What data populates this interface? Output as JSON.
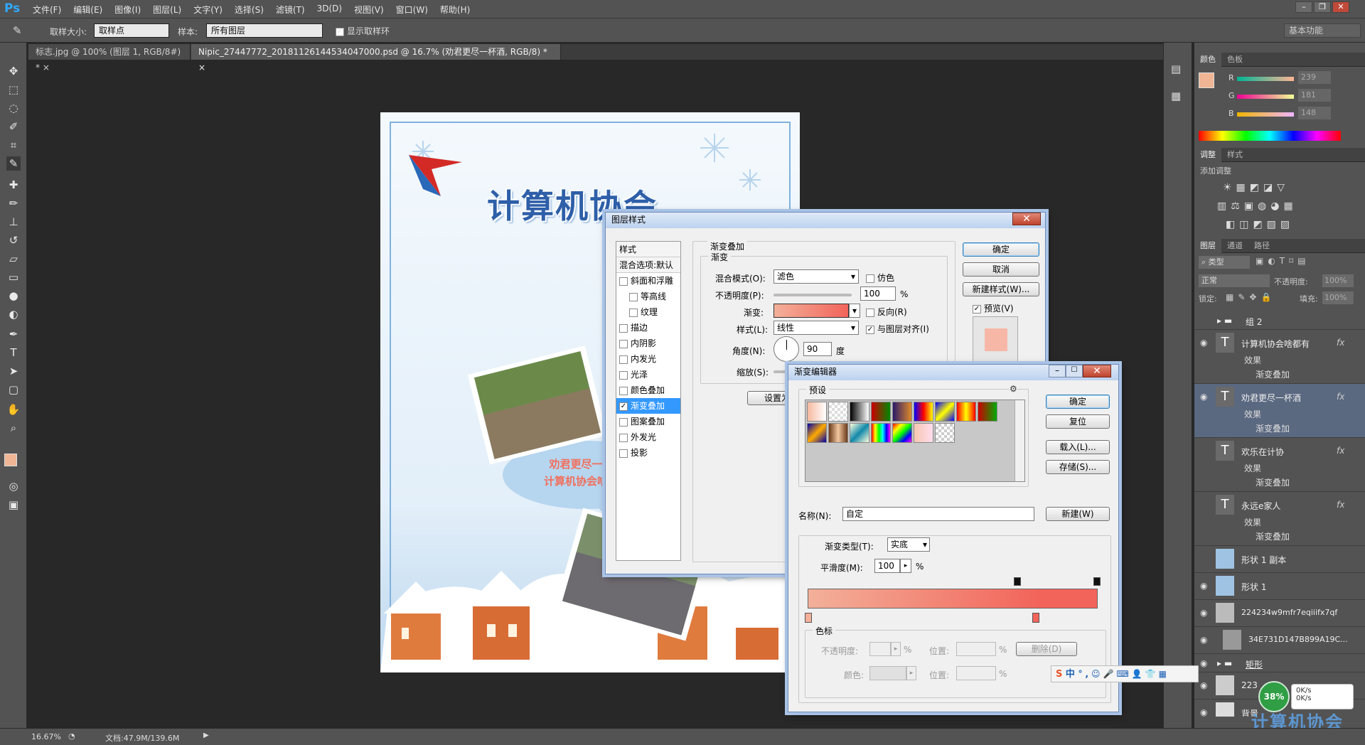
{
  "app": {
    "logo": "Ps"
  },
  "menu": [
    "文件(F)",
    "编辑(E)",
    "图像(I)",
    "图层(L)",
    "文字(Y)",
    "选择(S)",
    "滤镜(T)",
    "3D(D)",
    "视图(V)",
    "窗口(W)",
    "帮助(H)"
  ],
  "options": {
    "sample_size_label": "取样大小:",
    "sample_size_value": "取样点",
    "sample_label": "样本:",
    "sample_value": "所有图层",
    "show_ring_label": "显示取样环",
    "workspace": "基本功能"
  },
  "tabs": [
    {
      "label": "标志.jpg @ 100% (图层 1, RGB/8#) *"
    },
    {
      "label": "Nipic_27447772_20181126144534047000.psd @ 16.7% (劝君更尽一杯酒, RGB/8) *"
    }
  ],
  "status": {
    "zoom": "16.67%",
    "doc": "文档:47.9M/139.6M"
  },
  "color_panel": {
    "tabs": [
      "颜色",
      "色板"
    ],
    "r_label": "R",
    "g_label": "G",
    "b_label": "B",
    "r": "239",
    "g": "181",
    "b": "148",
    "fg_color": "#efb594"
  },
  "adjust_panel": {
    "tabs": [
      "调整",
      "样式"
    ],
    "add_label": "添加调整"
  },
  "layers_panel": {
    "tabs": [
      "图层",
      "通道",
      "路径"
    ],
    "filter_label": "类型",
    "blend": "正常",
    "opacity_label": "不透明度:",
    "opacity": "100%",
    "lock_label": "锁定:",
    "fill_label": "填充:",
    "fill": "100%",
    "layers": [
      {
        "name": "组 2",
        "kind": "group"
      },
      {
        "name": "计算机协会啥都有",
        "kind": "text",
        "fx": "fx",
        "effect": "效果",
        "sub": "渐变叠加"
      },
      {
        "name": "劝君更尽一杯酒",
        "kind": "text",
        "fx": "fx",
        "effect": "效果",
        "sub": "渐变叠加"
      },
      {
        "name": "欢乐在计协",
        "kind": "text",
        "fx": "fx",
        "effect": "效果",
        "sub": "渐变叠加"
      },
      {
        "name": "永远e家人",
        "kind": "text",
        "fx": "fx",
        "effect": "效果",
        "sub": "渐变叠加"
      },
      {
        "name": "形状 1 副本",
        "kind": "shape"
      },
      {
        "name": "形状 1",
        "kind": "shape"
      },
      {
        "name": "224234w9mfr7eqiiifx7qf",
        "kind": "image"
      },
      {
        "name": "34E731D147B899A19C...",
        "kind": "image"
      },
      {
        "name": "矩形",
        "kind": "group"
      },
      {
        "name": "223",
        "kind": "image"
      },
      {
        "name": "背景",
        "kind": "image"
      }
    ]
  },
  "poster": {
    "title": "计算机协会",
    "bubble_line1": "劝君更尽一杯酒",
    "bubble_line2": "计算机协会啥都有"
  },
  "layer_style": {
    "title": "图层样式",
    "styles_header": "样式",
    "blend_options": "混合选项:默认",
    "items": [
      {
        "label": "斜面和浮雕",
        "checked": false,
        "indent": false
      },
      {
        "label": "等高线",
        "checked": false,
        "indent": true
      },
      {
        "label": "纹理",
        "checked": false,
        "indent": true
      },
      {
        "label": "描边",
        "checked": false,
        "indent": false
      },
      {
        "label": "内阴影",
        "checked": false,
        "indent": false
      },
      {
        "label": "内发光",
        "checked": false,
        "indent": false
      },
      {
        "label": "光泽",
        "checked": false,
        "indent": false
      },
      {
        "label": "颜色叠加",
        "checked": false,
        "indent": false
      },
      {
        "label": "渐变叠加",
        "checked": true,
        "indent": false
      },
      {
        "label": "图案叠加",
        "checked": false,
        "indent": false
      },
      {
        "label": "外发光",
        "checked": false,
        "indent": false
      },
      {
        "label": "投影",
        "checked": false,
        "indent": false
      }
    ],
    "section": "渐变叠加",
    "subsection": "渐变",
    "blend_mode_label": "混合模式(O):",
    "blend_mode": "滤色",
    "dither": "仿色",
    "opacity_label": "不透明度(P):",
    "opacity": "100",
    "pct": "%",
    "gradient_label": "渐变:",
    "reverse": "反向(R)",
    "style_label": "样式(L):",
    "style": "线性",
    "align": "与图层对齐(I)",
    "angle_label": "角度(N):",
    "angle": "90",
    "deg": "度",
    "scale_label": "缩放(S):",
    "set_default": "设置为默认值",
    "ok": "确定",
    "cancel": "取消",
    "new_style": "新建样式(W)...",
    "preview": "预览(V)"
  },
  "gradient_editor": {
    "title": "渐变编辑器",
    "presets_label": "预设",
    "ok": "确定",
    "reset": "复位",
    "load": "载入(L)...",
    "save": "存储(S)...",
    "name_label": "名称(N):",
    "name": "自定",
    "new": "新建(W)",
    "type_label": "渐变类型(T):",
    "type": "实底",
    "smooth_label": "平滑度(M):",
    "smooth": "100",
    "pct": "%",
    "stops_label": "色标",
    "stop_opacity_label": "不透明度:",
    "position_label": "位置:",
    "delete": "删除(D)",
    "color_label": "颜色:",
    "grad_start": "#f3b09a",
    "grad_end": "#f2645a"
  },
  "ime": {
    "lang": "中"
  },
  "netmon": {
    "pct": "38%",
    "up": "0K/s",
    "down": "0K/s"
  },
  "watermark": "计算机协会"
}
